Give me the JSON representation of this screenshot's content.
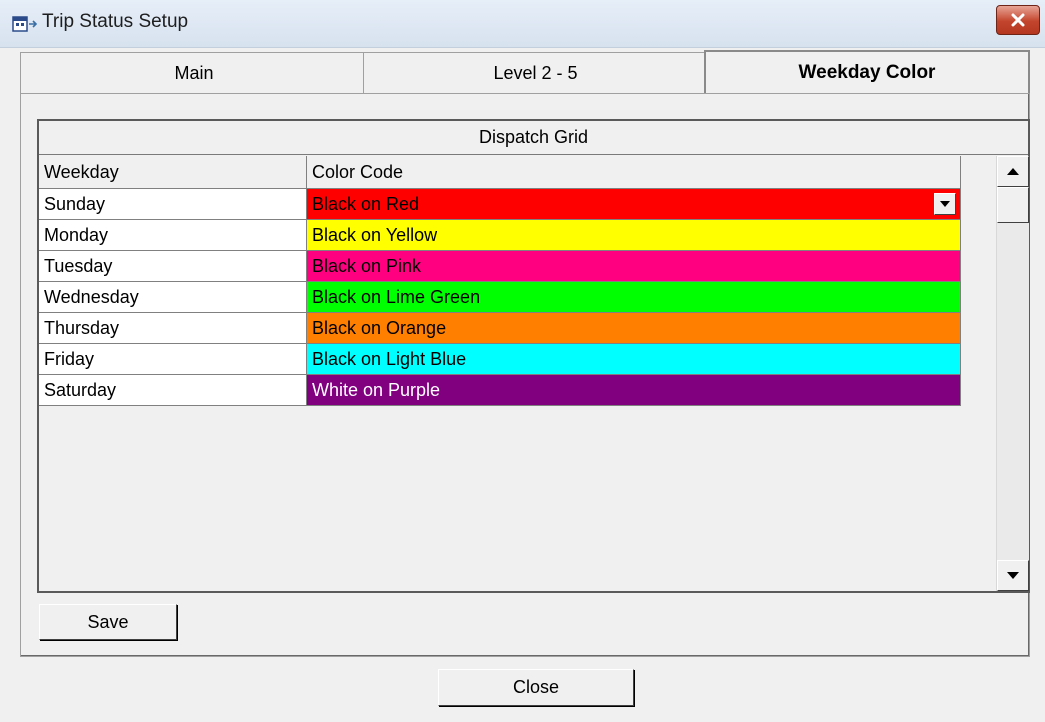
{
  "window": {
    "title": "Trip Status Setup"
  },
  "tabs": [
    {
      "label": "Main",
      "active": false
    },
    {
      "label": "Level 2 - 5",
      "active": false
    },
    {
      "label": "Weekday Color",
      "active": true
    }
  ],
  "grid": {
    "caption": "Dispatch Grid",
    "columns": [
      "Weekday",
      "Color Code"
    ],
    "rows": [
      {
        "day": "Sunday",
        "color_code": "Black on Red",
        "bg": "#ff0000",
        "fg": "#000000"
      },
      {
        "day": "Monday",
        "color_code": "Black on Yellow",
        "bg": "#ffff00",
        "fg": "#000000"
      },
      {
        "day": "Tuesday",
        "color_code": "Black on Pink",
        "bg": "#ff0080",
        "fg": "#000000"
      },
      {
        "day": "Wednesday",
        "color_code": "Black on Lime Green",
        "bg": "#00ff00",
        "fg": "#000000"
      },
      {
        "day": "Thursday",
        "color_code": "Black on Orange",
        "bg": "#ff8000",
        "fg": "#000000"
      },
      {
        "day": "Friday",
        "color_code": "Black on Light Blue",
        "bg": "#00ffff",
        "fg": "#000000"
      },
      {
        "day": "Saturday",
        "color_code": "White on Purple",
        "bg": "#800080",
        "fg": "#ffffff"
      }
    ]
  },
  "buttons": {
    "save": "Save",
    "close": "Close"
  }
}
